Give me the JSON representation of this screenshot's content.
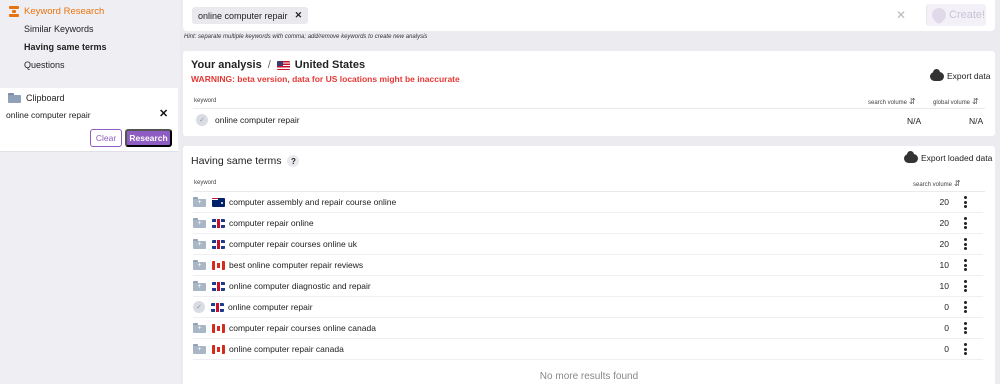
{
  "sidebar": {
    "title": "Keyword Research",
    "items": [
      {
        "label": "Similar Keywords",
        "active": false
      },
      {
        "label": "Having same terms",
        "active": true
      },
      {
        "label": "Questions",
        "active": false
      }
    ],
    "clipboard": {
      "title": "Clipboard",
      "text": "online computer repair",
      "clear_label": "Clear",
      "research_label": "Research"
    }
  },
  "search": {
    "chip": "online computer repair",
    "create_label": "Create!",
    "hint": "Hint: separate multiple keywords with comma; add/remove keywords to create new analysis"
  },
  "analysis": {
    "title": "Your analysis",
    "country": "United States",
    "warning": "WARNING: beta version, data for US locations might be inaccurate",
    "export_label": "Export data",
    "headers": {
      "keyword": "keyword",
      "search_volume": "search volume",
      "global_volume": "global volume"
    },
    "row": {
      "keyword": "online computer repair",
      "search_volume": "N/A",
      "global_volume": "N/A"
    }
  },
  "same_terms": {
    "title": "Having same terms",
    "export_label": "Export loaded data",
    "headers": {
      "keyword": "keyword",
      "search_volume": "search volume"
    },
    "rows": [
      {
        "flag": "au",
        "keyword": "computer assembly and repair course online",
        "volume": "20",
        "added": false
      },
      {
        "flag": "gb",
        "keyword": "computer repair online",
        "volume": "20",
        "added": false
      },
      {
        "flag": "gb",
        "keyword": "computer repair courses online uk",
        "volume": "20",
        "added": false
      },
      {
        "flag": "ca",
        "keyword": "best online computer repair reviews",
        "volume": "10",
        "added": false
      },
      {
        "flag": "gb",
        "keyword": "online computer diagnostic and repair",
        "volume": "10",
        "added": false
      },
      {
        "flag": "gb",
        "keyword": "online computer repair",
        "volume": "0",
        "added": true
      },
      {
        "flag": "ca",
        "keyword": "computer repair courses online canada",
        "volume": "0",
        "added": false
      },
      {
        "flag": "ca",
        "keyword": "online computer repair canada",
        "volume": "0",
        "added": false
      }
    ],
    "footer": "No more results found"
  },
  "colors": {
    "accent": "#8e5cc2",
    "brand": "#e8730e",
    "warning": "#e53935"
  }
}
